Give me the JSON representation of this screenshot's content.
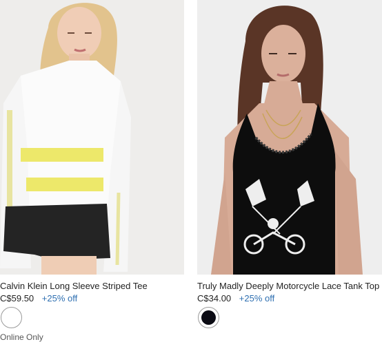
{
  "colors": {
    "promo": "#2e6fb1"
  },
  "products": [
    {
      "title": "Calvin Klein Long Sleeve Striped Tee",
      "price": "C$59.50",
      "promo": "+25% off",
      "swatch": {
        "color": "#ffffff"
      },
      "availability": "Online Only"
    },
    {
      "title": "Truly Madly Deeply Motorcycle Lace Tank Top",
      "price": "C$34.00",
      "promo": "+25% off",
      "swatch": {
        "color": "#0b0b14"
      }
    }
  ]
}
